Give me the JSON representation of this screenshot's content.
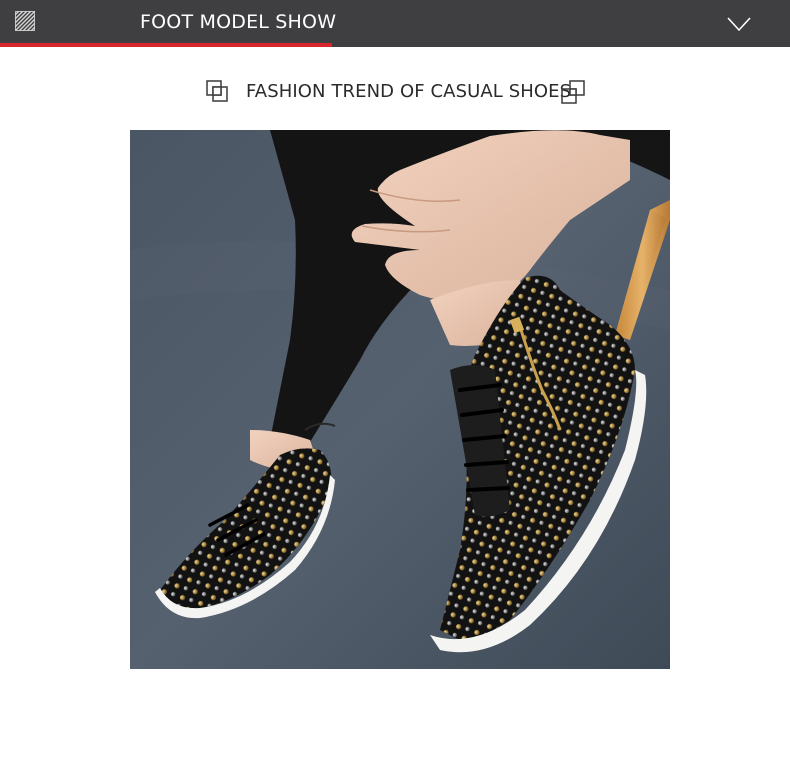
{
  "header": {
    "title": "FOOT MODEL SHOW",
    "menu_icon": "hatch-icon",
    "expand_icon": "chevron-down-icon",
    "background": "#3f3f41",
    "accent": "#d7252b"
  },
  "section": {
    "subtitle": "FASHION TREND OF CASUAL SHOES",
    "left_icon": "overlapping-squares-icon",
    "right_icon": "overlapping-squares-icon"
  },
  "photo": {
    "subject": "model-wearing-studded-sneakers"
  }
}
